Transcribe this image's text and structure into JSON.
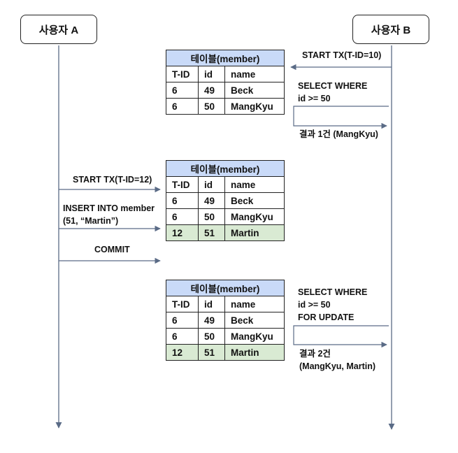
{
  "actors": {
    "a": "사용자 A",
    "b": "사용자 B"
  },
  "tables": [
    {
      "title": "테이블(member)",
      "headers": [
        "T-ID",
        "id",
        "name"
      ],
      "rows": [
        [
          "6",
          "49",
          "Beck"
        ],
        [
          "6",
          "50",
          "MangKyu"
        ]
      ]
    },
    {
      "title": "테이블(member)",
      "headers": [
        "T-ID",
        "id",
        "name"
      ],
      "rows": [
        [
          "6",
          "49",
          "Beck"
        ],
        [
          "6",
          "50",
          "MangKyu"
        ],
        [
          "12",
          "51",
          "Martin"
        ]
      ]
    },
    {
      "title": "테이블(member)",
      "headers": [
        "T-ID",
        "id",
        "name"
      ],
      "rows": [
        [
          "6",
          "49",
          "Beck"
        ],
        [
          "6",
          "50",
          "MangKyu"
        ],
        [
          "12",
          "51",
          "Martin"
        ]
      ]
    }
  ],
  "messages": {
    "b_start": "START TX(T-ID=10)",
    "b_select1": "SELECT WHERE\nid >= 50",
    "b_result1": "결과 1건 (MangKyu)",
    "a_start": "START TX(T-ID=12)",
    "a_insert": "INSERT INTO member\n(51, “Martin”)",
    "a_commit": "COMMIT",
    "b_select2": "SELECT WHERE\nid >= 50\nFOR UPDATE",
    "b_result2": "결과 2건\n(MangKyu, Martin)"
  },
  "colors": {
    "line": "#5a6b86",
    "header_bg": "#c9daf8",
    "new_row_bg": "#d9ead3"
  }
}
